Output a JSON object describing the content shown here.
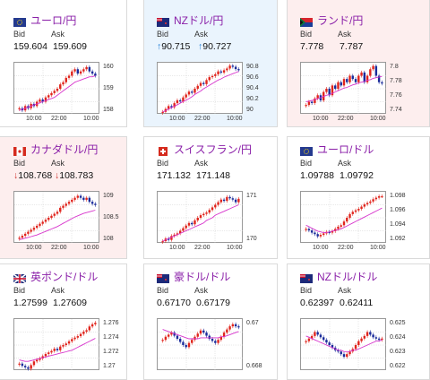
{
  "colors": {
    "bull": "#e0241c",
    "bear": "#1a2b9a",
    "ma": "#d733cc",
    "title": "#8a1fa8",
    "grid": "#d0d0d0"
  },
  "labels": {
    "bid": "Bid",
    "ask": "Ask"
  },
  "cards": [
    {
      "title": "ユーロ/円",
      "flag": "eu-flag-icon",
      "bid": "159.604",
      "ask": "159.609",
      "direction": "none",
      "highlight": "none",
      "yticks": [
        "160",
        "159",
        "158"
      ],
      "xticks": [
        "10:00",
        "22:00",
        "10:00"
      ],
      "chart_data": {
        "type": "candlestick",
        "ylim": [
          157.8,
          160.2
        ],
        "close_path": [
          158.1,
          158.0,
          158.2,
          158.1,
          158.3,
          158.2,
          158.4,
          158.5,
          158.4,
          158.6,
          158.7,
          158.8,
          158.9,
          159.0,
          159.2,
          159.3,
          159.5,
          159.6,
          159.8,
          159.9,
          159.7,
          159.8,
          159.9,
          160.0,
          159.8,
          159.7,
          159.6
        ],
        "ma_path": [
          158.0,
          158.05,
          158.1,
          158.15,
          158.2,
          158.25,
          158.3,
          158.35,
          158.4,
          158.45,
          158.5,
          158.55,
          158.6,
          158.7,
          158.8,
          158.9,
          159.0,
          159.1,
          159.2,
          159.3,
          159.35,
          159.4,
          159.45,
          159.5,
          159.55,
          159.55,
          159.6
        ]
      }
    },
    {
      "title": "NZドル/円",
      "flag": "nz-flag-icon",
      "bid": "90.715",
      "ask": "90.727",
      "direction": "up",
      "highlight": "blue",
      "yticks": [
        "90.8",
        "90.6",
        "90.4",
        "90.2",
        "90"
      ],
      "xticks": [
        "10:00",
        "22:00",
        "10:00"
      ],
      "chart_data": {
        "type": "candlestick",
        "ylim": [
          89.95,
          90.85
        ],
        "close_path": [
          90.0,
          90.05,
          90.1,
          90.08,
          90.15,
          90.2,
          90.18,
          90.25,
          90.3,
          90.35,
          90.33,
          90.4,
          90.45,
          90.5,
          90.48,
          90.55,
          90.6,
          90.62,
          90.65,
          90.7,
          90.68,
          90.72,
          90.75,
          90.8,
          90.78,
          90.74,
          90.72
        ],
        "ma_path": [
          90.0,
          90.02,
          90.05,
          90.07,
          90.1,
          90.12,
          90.15,
          90.18,
          90.2,
          90.23,
          90.26,
          90.3,
          90.33,
          90.36,
          90.4,
          90.43,
          90.46,
          90.49,
          90.52,
          90.55,
          90.57,
          90.6,
          90.62,
          90.64,
          90.66,
          90.68,
          90.7
        ]
      }
    },
    {
      "title": "ランド/円",
      "flag": "za-flag-icon",
      "bid": "7.778",
      "ask": "7.787",
      "direction": "none",
      "highlight": "pink",
      "yticks": [
        "7.8",
        "7.78",
        "7.76",
        "7.74"
      ],
      "xticks": [
        "10:00",
        "22:00",
        "10:00"
      ],
      "chart_data": {
        "type": "candlestick",
        "ylim": [
          7.73,
          7.81
        ],
        "close_path": [
          7.745,
          7.75,
          7.748,
          7.755,
          7.76,
          7.752,
          7.765,
          7.77,
          7.76,
          7.775,
          7.77,
          7.78,
          7.775,
          7.785,
          7.78,
          7.79,
          7.785,
          7.78,
          7.79,
          7.795,
          7.78,
          7.79,
          7.8,
          7.805,
          7.79,
          7.78,
          7.778
        ],
        "ma_path": [
          7.75,
          7.751,
          7.752,
          7.753,
          7.755,
          7.756,
          7.758,
          7.76,
          7.761,
          7.763,
          7.765,
          7.767,
          7.769,
          7.771,
          7.772,
          7.774,
          7.776,
          7.777,
          7.779,
          7.78,
          7.781,
          7.783,
          7.784,
          7.786,
          7.787,
          7.788,
          7.789
        ]
      }
    },
    {
      "title": "カナダドル/円",
      "flag": "ca-flag-icon",
      "bid": "108.768",
      "ask": "108.783",
      "direction": "down",
      "highlight": "pink",
      "yticks": [
        "109",
        "108.5",
        "108"
      ],
      "xticks": [
        "10:00",
        "22:00",
        "10:00"
      ],
      "chart_data": {
        "type": "candlestick",
        "ylim": [
          107.8,
          109.1
        ],
        "close_path": [
          107.95,
          108.0,
          108.05,
          108.1,
          108.15,
          108.2,
          108.25,
          108.3,
          108.35,
          108.4,
          108.45,
          108.5,
          108.55,
          108.6,
          108.7,
          108.75,
          108.8,
          108.85,
          108.9,
          108.95,
          109.0,
          108.95,
          108.9,
          108.95,
          108.85,
          108.8,
          108.77
        ],
        "ma_path": [
          107.9,
          107.92,
          107.94,
          107.96,
          107.98,
          108.0,
          108.02,
          108.05,
          108.08,
          108.11,
          108.14,
          108.17,
          108.2,
          108.23,
          108.27,
          108.31,
          108.35,
          108.39,
          108.43,
          108.47,
          108.5,
          108.53,
          108.56,
          108.58,
          108.6,
          108.62,
          108.64
        ]
      }
    },
    {
      "title": "スイスフラン/円",
      "flag": "ch-flag-icon",
      "bid": "171.132",
      "ask": "171.148",
      "direction": "none",
      "highlight": "none",
      "yticks": [
        "171",
        "170"
      ],
      "xticks": [
        "10:00",
        "22:00",
        "10:00"
      ],
      "chart_data": {
        "type": "candlestick",
        "ylim": [
          169.4,
          171.4
        ],
        "close_path": [
          169.5,
          169.6,
          169.55,
          169.7,
          169.75,
          169.8,
          169.9,
          170.0,
          170.1,
          170.2,
          170.15,
          170.3,
          170.4,
          170.5,
          170.55,
          170.6,
          170.7,
          170.8,
          170.9,
          171.0,
          171.1,
          171.05,
          171.2,
          171.15,
          171.1,
          171.0,
          171.13
        ],
        "ma_path": [
          169.5,
          169.55,
          169.6,
          169.65,
          169.7,
          169.75,
          169.8,
          169.85,
          169.9,
          169.95,
          170.0,
          170.05,
          170.1,
          170.15,
          170.2,
          170.3,
          170.35,
          170.4,
          170.5,
          170.55,
          170.6,
          170.65,
          170.7,
          170.75,
          170.8,
          170.85,
          170.9
        ]
      }
    },
    {
      "title": "ユーロ/ドル",
      "flag": "eu-flag-icon",
      "bid": "1.09788",
      "ask": "1.09792",
      "direction": "none",
      "highlight": "none",
      "yticks": [
        "1.098",
        "1.096",
        "1.094",
        "1.092"
      ],
      "xticks": [
        "10:00",
        "22:00",
        "10:00"
      ],
      "chart_data": {
        "type": "candlestick",
        "ylim": [
          1.0915,
          1.0985
        ],
        "close_path": [
          1.0935,
          1.0933,
          1.093,
          1.0928,
          1.0925,
          1.0927,
          1.0929,
          1.0931,
          1.093,
          1.0932,
          1.0935,
          1.0938,
          1.094,
          1.0945,
          1.095,
          1.0955,
          1.0958,
          1.096,
          1.0962,
          1.0965,
          1.0968,
          1.097,
          1.0972,
          1.0975,
          1.0977,
          1.0979,
          1.0979
        ],
        "ma_path": [
          1.094,
          1.0938,
          1.0936,
          1.0934,
          1.0932,
          1.0931,
          1.093,
          1.093,
          1.0931,
          1.0932,
          1.0933,
          1.0934,
          1.0935,
          1.0937,
          1.0939,
          1.0941,
          1.0943,
          1.0945,
          1.0947,
          1.0949,
          1.0951,
          1.0953,
          1.0955,
          1.0957,
          1.0959,
          1.0961,
          1.0963
        ]
      }
    },
    {
      "title": "英ポンド/ドル",
      "flag": "gb-flag-icon",
      "bid": "1.27599",
      "ask": "1.27609",
      "direction": "none",
      "highlight": "none",
      "yticks": [
        "1.276",
        "1.274",
        "1.272",
        "1.27"
      ],
      "xticks": [],
      "chart_data": {
        "type": "candlestick",
        "ylim": [
          1.2695,
          1.2765
        ],
        "close_path": [
          1.2705,
          1.2702,
          1.27,
          1.2698,
          1.2703,
          1.2708,
          1.271,
          1.2712,
          1.2715,
          1.2718,
          1.272,
          1.2722,
          1.2725,
          1.2723,
          1.2728,
          1.273,
          1.2732,
          1.2735,
          1.2738,
          1.274,
          1.2742,
          1.2745,
          1.2748,
          1.275,
          1.2755,
          1.2758,
          1.276
        ],
        "ma_path": [
          1.271,
          1.2709,
          1.2708,
          1.2708,
          1.2709,
          1.271,
          1.2711,
          1.2712,
          1.2713,
          1.2714,
          1.2715,
          1.2716,
          1.2717,
          1.2718,
          1.2719,
          1.272,
          1.2721,
          1.2722,
          1.2723,
          1.2725,
          1.2727,
          1.2729,
          1.2731,
          1.2733,
          1.2735,
          1.2737,
          1.2739
        ]
      }
    },
    {
      "title": "豪ドル/ドル",
      "flag": "au-flag-icon",
      "bid": "0.67170",
      "ask": "0.67179",
      "direction": "none",
      "highlight": "none",
      "yticks": [
        "0.67",
        "0.668"
      ],
      "xticks": [],
      "chart_data": {
        "type": "candlestick",
        "ylim": [
          0.6675,
          0.6725
        ],
        "close_path": [
          0.6705,
          0.6708,
          0.671,
          0.6712,
          0.6709,
          0.6706,
          0.6703,
          0.67,
          0.6698,
          0.6702,
          0.6705,
          0.6708,
          0.6711,
          0.6714,
          0.6712,
          0.6709,
          0.6706,
          0.6704,
          0.6702,
          0.6705,
          0.6708,
          0.6712,
          0.6715,
          0.6718,
          0.672,
          0.6718,
          0.6717
        ],
        "ma_path": [
          0.6715,
          0.6714,
          0.6713,
          0.6712,
          0.6711,
          0.671,
          0.6709,
          0.6708,
          0.6707,
          0.6706,
          0.6706,
          0.6706,
          0.6706,
          0.6707,
          0.6707,
          0.6707,
          0.6707,
          0.6707,
          0.6707,
          0.6707,
          0.6708,
          0.6708,
          0.6709,
          0.671,
          0.6711,
          0.6712,
          0.6713
        ]
      }
    },
    {
      "title": "NZドル/ドル",
      "flag": "nz-flag-icon",
      "bid": "0.62397",
      "ask": "0.62411",
      "direction": "none",
      "highlight": "none",
      "yticks": [
        "0.625",
        "0.624",
        "0.623",
        "0.622"
      ],
      "xticks": [],
      "chart_data": {
        "type": "candlestick",
        "ylim": [
          0.6215,
          0.6255
        ],
        "close_path": [
          0.6238,
          0.624,
          0.6242,
          0.6245,
          0.6243,
          0.6241,
          0.6239,
          0.6237,
          0.6235,
          0.6233,
          0.6231,
          0.623,
          0.6228,
          0.6226,
          0.6228,
          0.623,
          0.6232,
          0.6235,
          0.6238,
          0.624,
          0.6242,
          0.6245,
          0.6243,
          0.6241,
          0.624,
          0.6239,
          0.624
        ],
        "ma_path": [
          0.6242,
          0.6241,
          0.624,
          0.6239,
          0.6238,
          0.6237,
          0.6236,
          0.6235,
          0.6234,
          0.6233,
          0.6232,
          0.6231,
          0.6231,
          0.623,
          0.623,
          0.623,
          0.6231,
          0.6231,
          0.6232,
          0.6233,
          0.6234,
          0.6235,
          0.6236,
          0.6237,
          0.6238,
          0.6238,
          0.6239
        ]
      }
    }
  ]
}
